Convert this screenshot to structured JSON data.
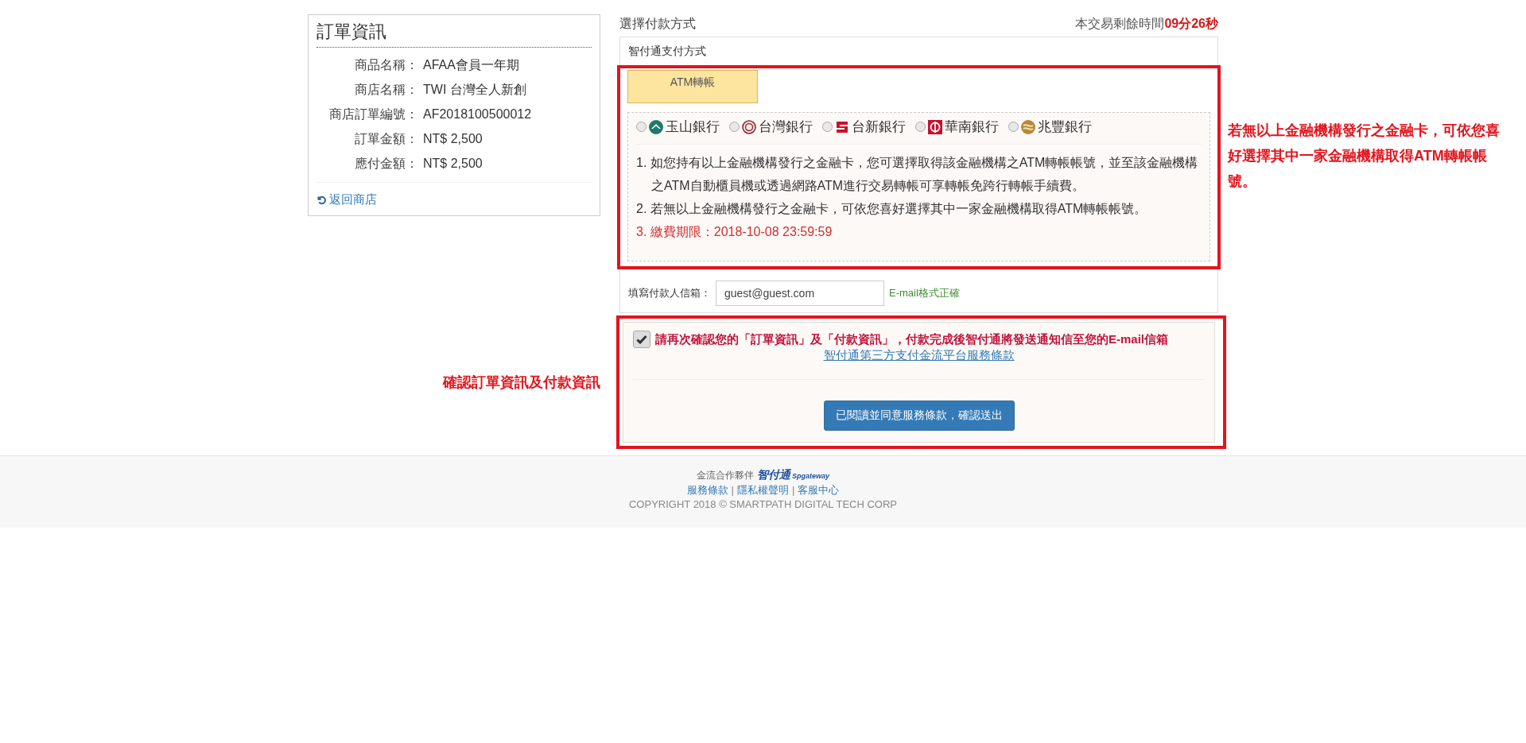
{
  "order_info": {
    "title": "訂單資訊",
    "rows": [
      {
        "label": "商品名稱：",
        "value": "AFAA會員一年期"
      },
      {
        "label": "商店名稱：",
        "value": "TWI 台灣全人新創"
      },
      {
        "label": "商店訂單編號：",
        "value": "AF2018100500012"
      },
      {
        "label": "訂單金額：",
        "value": "NT$ 2,500"
      },
      {
        "label": "應付金額：",
        "value": "NT$ 2,500"
      }
    ],
    "back_link": "返回商店"
  },
  "payment": {
    "title": "選擇付款方式",
    "timer_label": "本交易剩餘時間",
    "timer_value": "09分26秒",
    "panel_title": "智付通支付方式",
    "method_tab": {
      "label": "ATM轉帳",
      "selected": true
    },
    "banks": [
      {
        "name": "玉山銀行",
        "kind": "mountain",
        "selected": false
      },
      {
        "name": "台灣銀行",
        "kind": "seal",
        "selected": false
      },
      {
        "name": "台新銀行",
        "kind": "ribbon",
        "selected": false
      },
      {
        "name": "華南銀行",
        "kind": "square",
        "selected": false
      },
      {
        "name": "兆豐銀行",
        "kind": "sphere",
        "selected": false
      }
    ],
    "notes": [
      {
        "text": "1. 如您持有以上金融機構發行之金融卡，您可選擇取得該金融機構之ATM轉帳帳號，並至該金融機構之ATM自動櫃員機或透過網路ATM進行交易轉帳可享轉帳免跨行轉帳手續費。",
        "highlight": false
      },
      {
        "text": "2. 若無以上金融機構發行之金融卡，可依您喜好選擇其中一家金融機構取得ATM轉帳帳號。",
        "highlight": false
      },
      {
        "text": "3. 繳費期限：2018-10-08 23:59:59",
        "highlight": true
      }
    ],
    "email": {
      "label": "填寫付款人信箱：",
      "value": "guest@guest.com",
      "status": "E-mail格式正確"
    }
  },
  "confirm": {
    "checked": true,
    "text": "請再次確認您的「訂單資訊」及「付款資訊」，付款完成後智付通將發送通知信至您的E-mail信箱",
    "terms_link": "智付通第三方支付金流平台服務條款",
    "submit": "已閱讀並同意服務條款，確認送出"
  },
  "annotations": {
    "right": "若無以上金融機構發行之金融卡，可依您喜好選擇其中一家金融機構取得ATM轉帳帳號。",
    "left": "確認訂單資訊及付款資訊"
  },
  "footer": {
    "partner_label": "金流合作夥伴",
    "partner_logo": "智付通",
    "partner_logo_sub": "Spgateway",
    "links": [
      "服務條款",
      "隱私權聲明",
      "客服中心"
    ],
    "separators": [
      "|",
      "|"
    ],
    "copyright": "COPYRIGHT 2018 © SMARTPATH DIGITAL TECH CORP"
  }
}
